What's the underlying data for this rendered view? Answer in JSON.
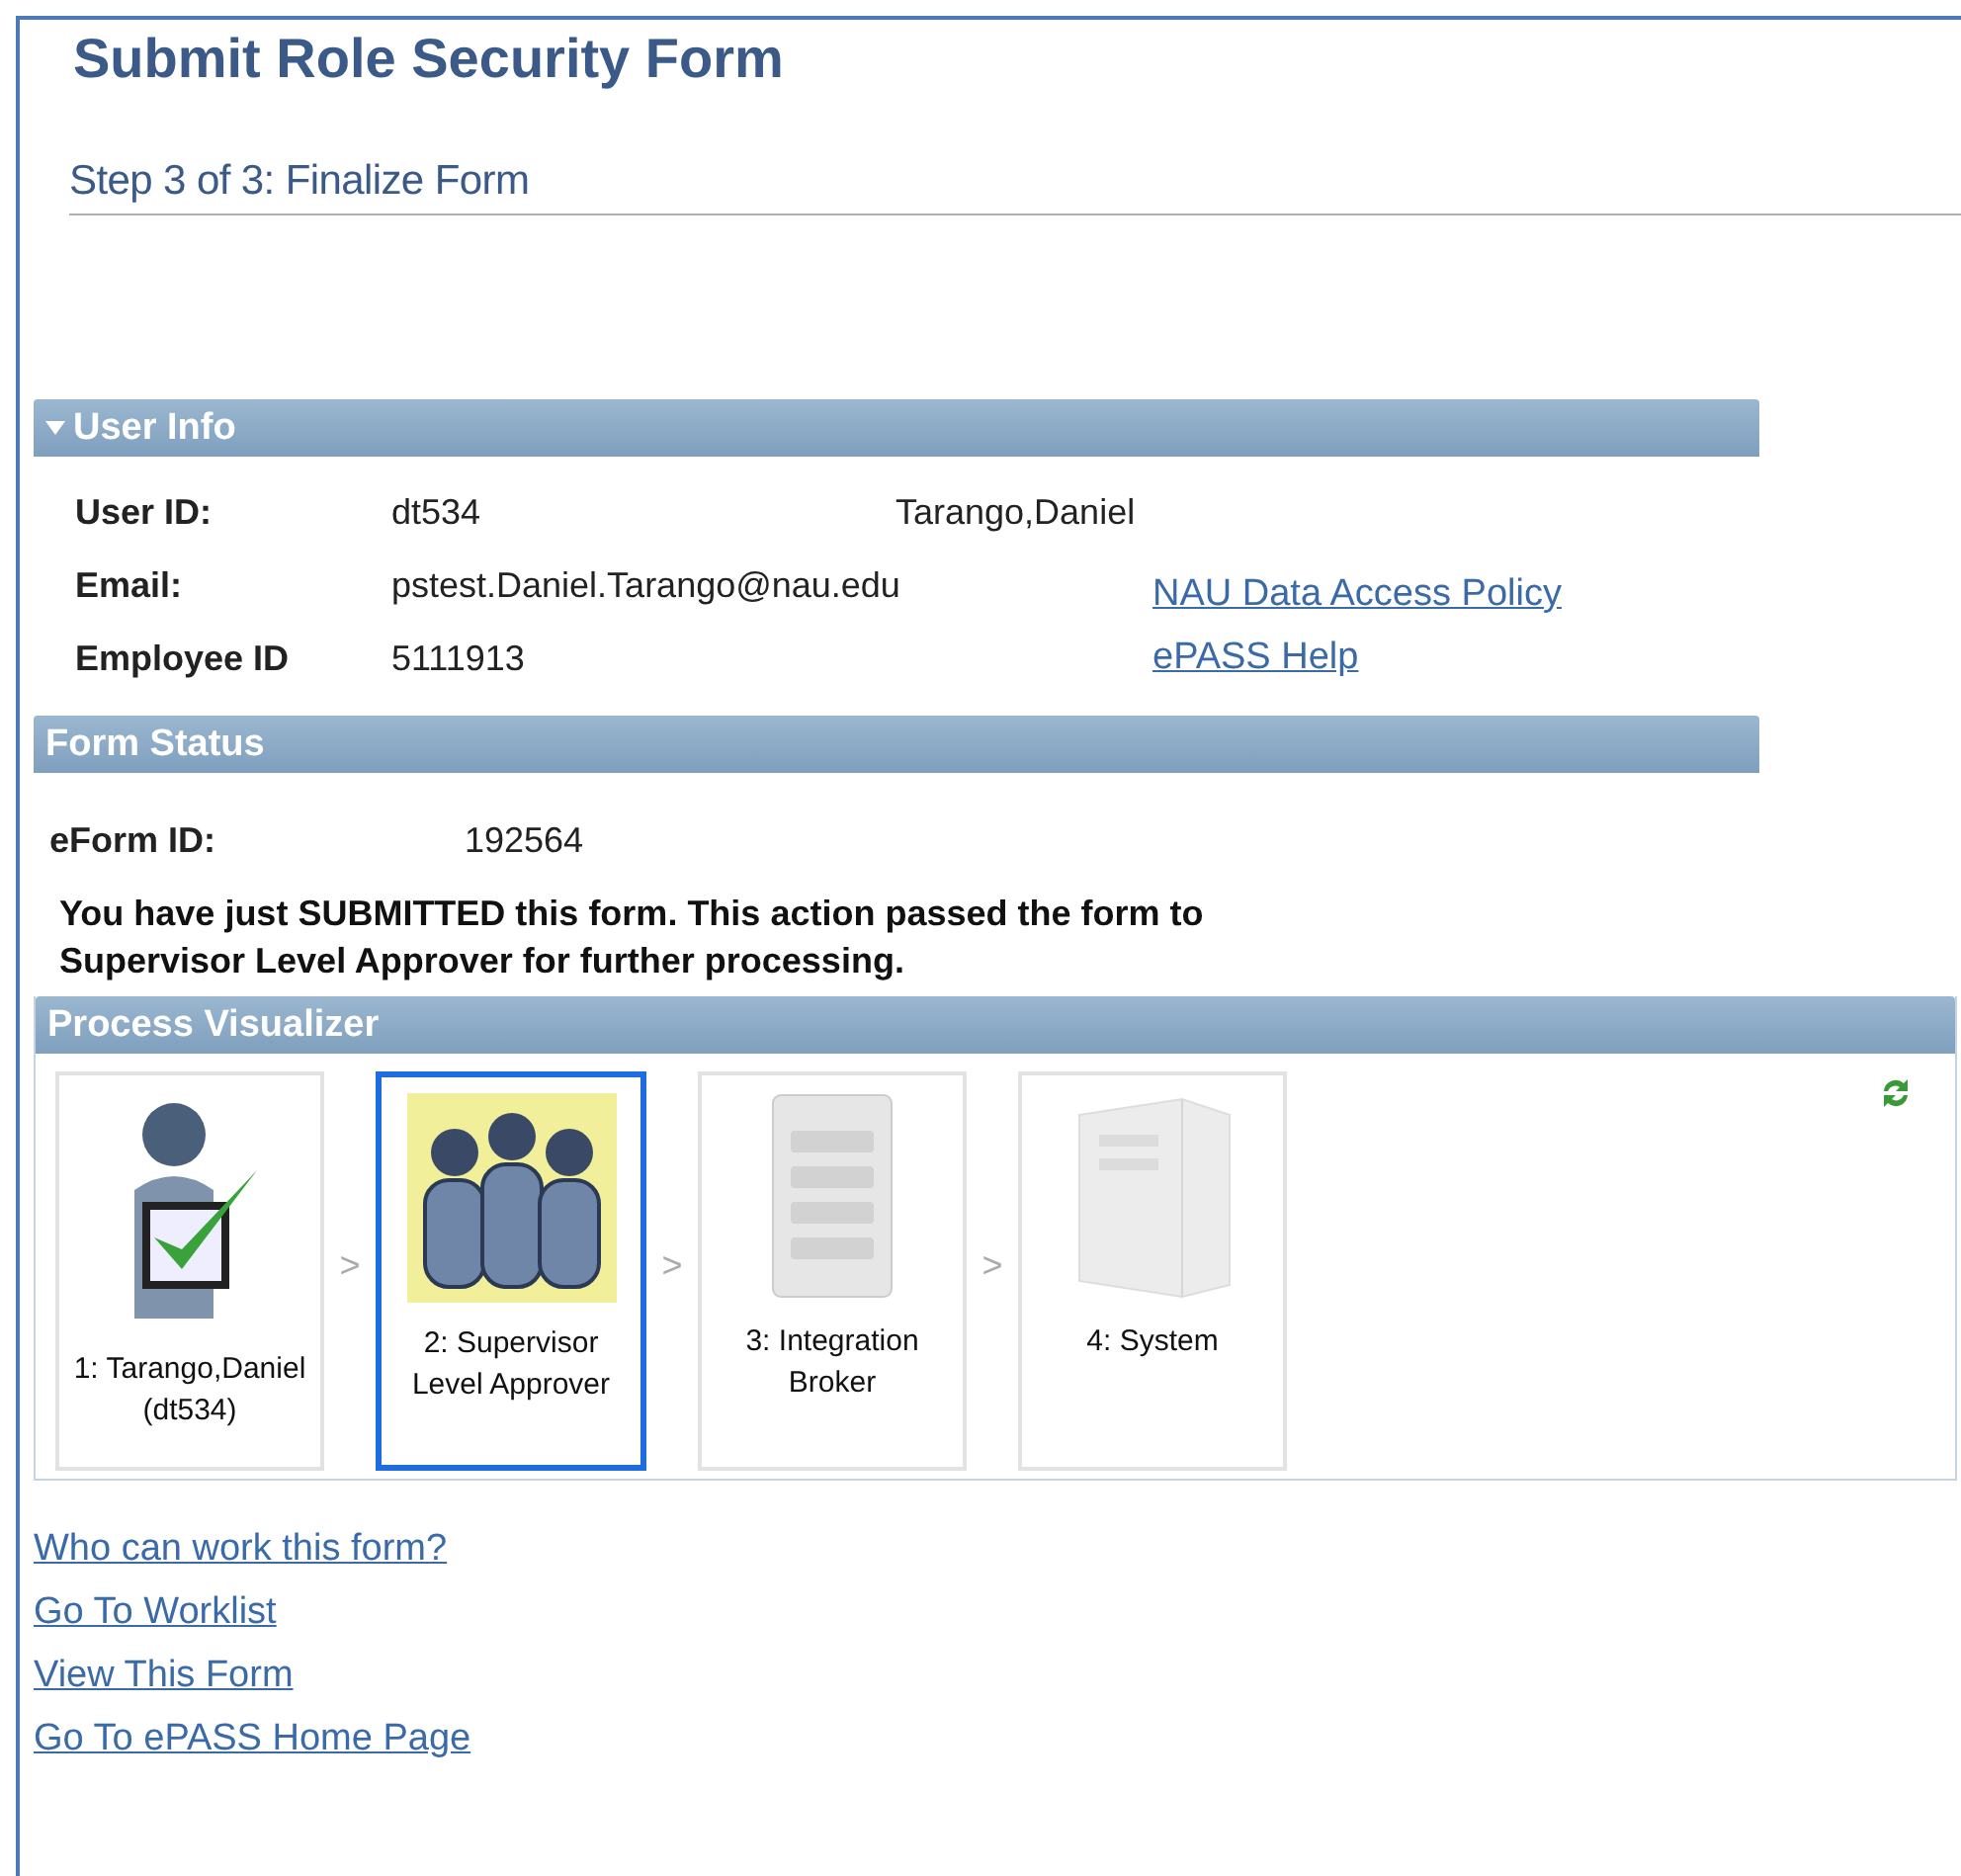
{
  "title": "Submit Role Security Form",
  "step": "Step 3 of 3: Finalize Form",
  "user_info": {
    "header": "User Info",
    "expanded": true,
    "fields": [
      {
        "label": "User ID:",
        "value": "dt534",
        "extra": "Tarango,Daniel"
      },
      {
        "label": "Email:",
        "value": "pstest.Daniel.Tarango@nau.edu"
      },
      {
        "label": "Employee ID",
        "value": "5111913"
      }
    ],
    "links": [
      "NAU Data Access Policy",
      "ePASS Help"
    ]
  },
  "form_status": {
    "header": "Form Status",
    "eform_label": "eForm ID:",
    "eform_id": "192564",
    "message": "You have just SUBMITTED this form. This action passed the form to Supervisor Level Approver for further processing."
  },
  "process_visualizer": {
    "header": "Process Visualizer",
    "separator": ">",
    "steps": [
      {
        "kind": "person",
        "label": "1: Tarango,Daniel (dt534)",
        "selected": false
      },
      {
        "kind": "group",
        "label": "2: Supervisor Level Approver",
        "selected": true
      },
      {
        "kind": "broker",
        "label": "3: Integration Broker",
        "selected": false
      },
      {
        "kind": "system",
        "label": "4: System",
        "selected": false
      }
    ]
  },
  "links": [
    "Who can work this form?",
    "Go To Worklist",
    "View This Form",
    "Go To ePASS Home Page"
  ]
}
